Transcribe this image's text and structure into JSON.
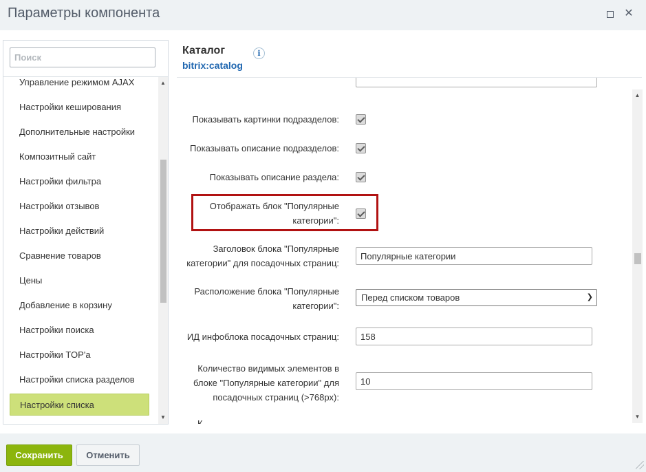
{
  "window": {
    "title": "Параметры компонента",
    "maximize_icon": "maximize-icon",
    "close_icon": "close-icon",
    "close_glyph": "✕"
  },
  "sidebar": {
    "search_placeholder": "Поиск",
    "items": [
      {
        "label": "Управление режимом AJAX",
        "active": false
      },
      {
        "label": "Настройки кеширования",
        "active": false
      },
      {
        "label": "Дополнительные настройки",
        "active": false
      },
      {
        "label": "Композитный сайт",
        "active": false
      },
      {
        "label": "Настройки фильтра",
        "active": false
      },
      {
        "label": "Настройки отзывов",
        "active": false
      },
      {
        "label": "Настройки действий",
        "active": false
      },
      {
        "label": "Сравнение товаров",
        "active": false
      },
      {
        "label": "Цены",
        "active": false
      },
      {
        "label": "Добавление в корзину",
        "active": false
      },
      {
        "label": "Настройки поиска",
        "active": false
      },
      {
        "label": "Настройки TOP'a",
        "active": false
      },
      {
        "label": "Настройки списка разделов",
        "active": false
      },
      {
        "label": "Настройки списка",
        "active": true
      }
    ],
    "scroll_up_glyph": "▲",
    "scroll_down_glyph": "▼"
  },
  "component": {
    "title": "Каталог",
    "code": "bitrix:catalog",
    "info_glyph": "i"
  },
  "settings": {
    "show_section_pictures": {
      "label": "Показывать картинки подразделов:",
      "checked": true
    },
    "show_subsection_desc": {
      "label": "Показывать описание подразделов:",
      "checked": true
    },
    "show_section_desc": {
      "label": "Показывать описание раздела:",
      "checked": true
    },
    "show_popular_block": {
      "label": "Отображать блок \"Популярные категории\":",
      "checked": true
    },
    "popular_block_title": {
      "label": "Заголовок блока \"Популярные категории\" для посадочных страниц:",
      "value": "Популярные категории"
    },
    "popular_block_position": {
      "label": "Расположение блока \"Популярные категории\":",
      "value": "Перед списком товаров"
    },
    "landing_iblock_id": {
      "label": "ИД инфоблока посадочных страниц:",
      "value": "158"
    },
    "visible_count": {
      "label": "Количество видимых элементов в блоке \"Популярные категории\" для посадочных страниц (>768px):",
      "value": "10"
    },
    "highlight_color": "#b11212"
  },
  "footer": {
    "save_label": "Сохранить",
    "cancel_label": "Отменить"
  },
  "colors": {
    "save_button": "#8cb50d",
    "active_item": "#cde07a",
    "link_blue": "#2067b0"
  }
}
